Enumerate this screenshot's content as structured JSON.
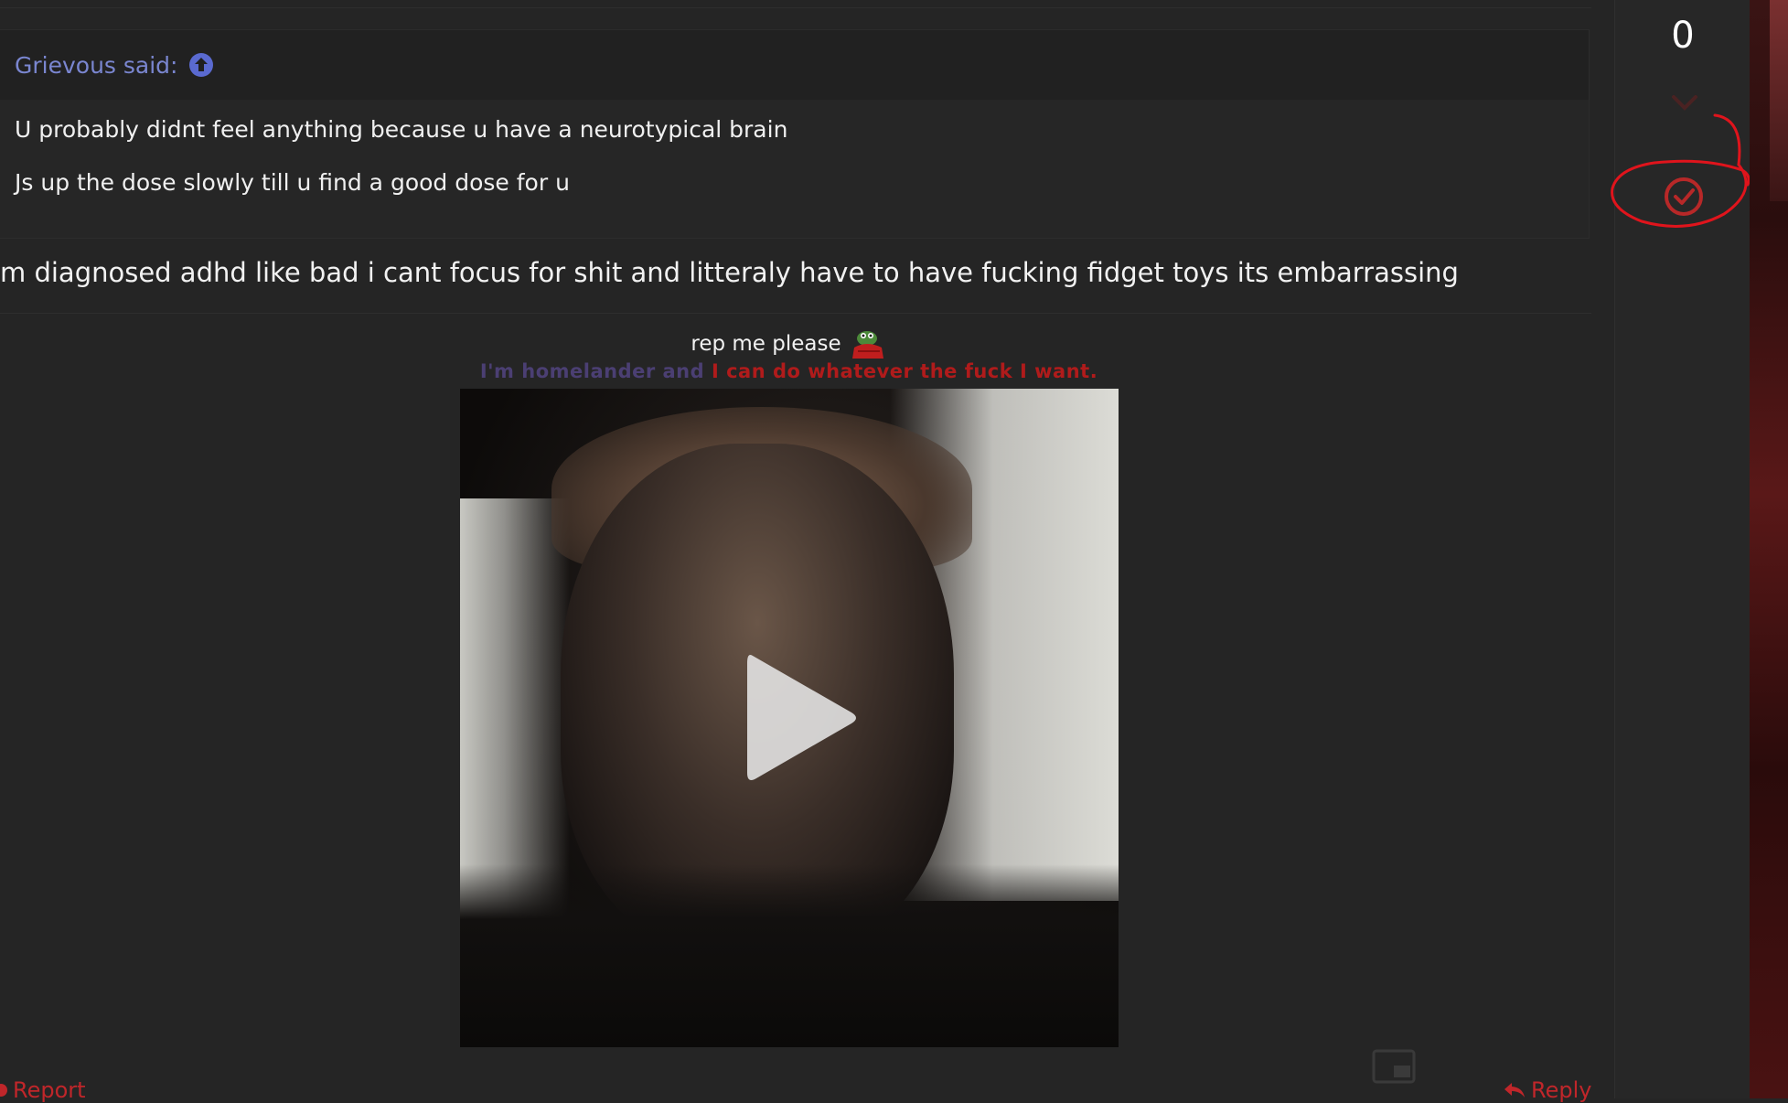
{
  "quote": {
    "author_label": "Grievous said:",
    "lines": [
      "U probably didnt feel anything because u have a neurotypical brain",
      "Js up the dose slowly till u find a good dose for u"
    ]
  },
  "post": {
    "text": "m diagnosed adhd like bad i cant focus for shit and litteraly have to have fucking fidget toys its embarrassing"
  },
  "signature": {
    "line1": "rep me please",
    "line2_part1": "I'm homelander and ",
    "line2_part2": "I can do whatever the fuck I want."
  },
  "actions": {
    "report_label": "Report",
    "reply_label": "Reply"
  },
  "vote": {
    "count": "0"
  },
  "colors": {
    "link_blue": "#7a86d0",
    "action_red": "#c0262a",
    "annotation_red": "#e0141c",
    "background": "#252525"
  }
}
